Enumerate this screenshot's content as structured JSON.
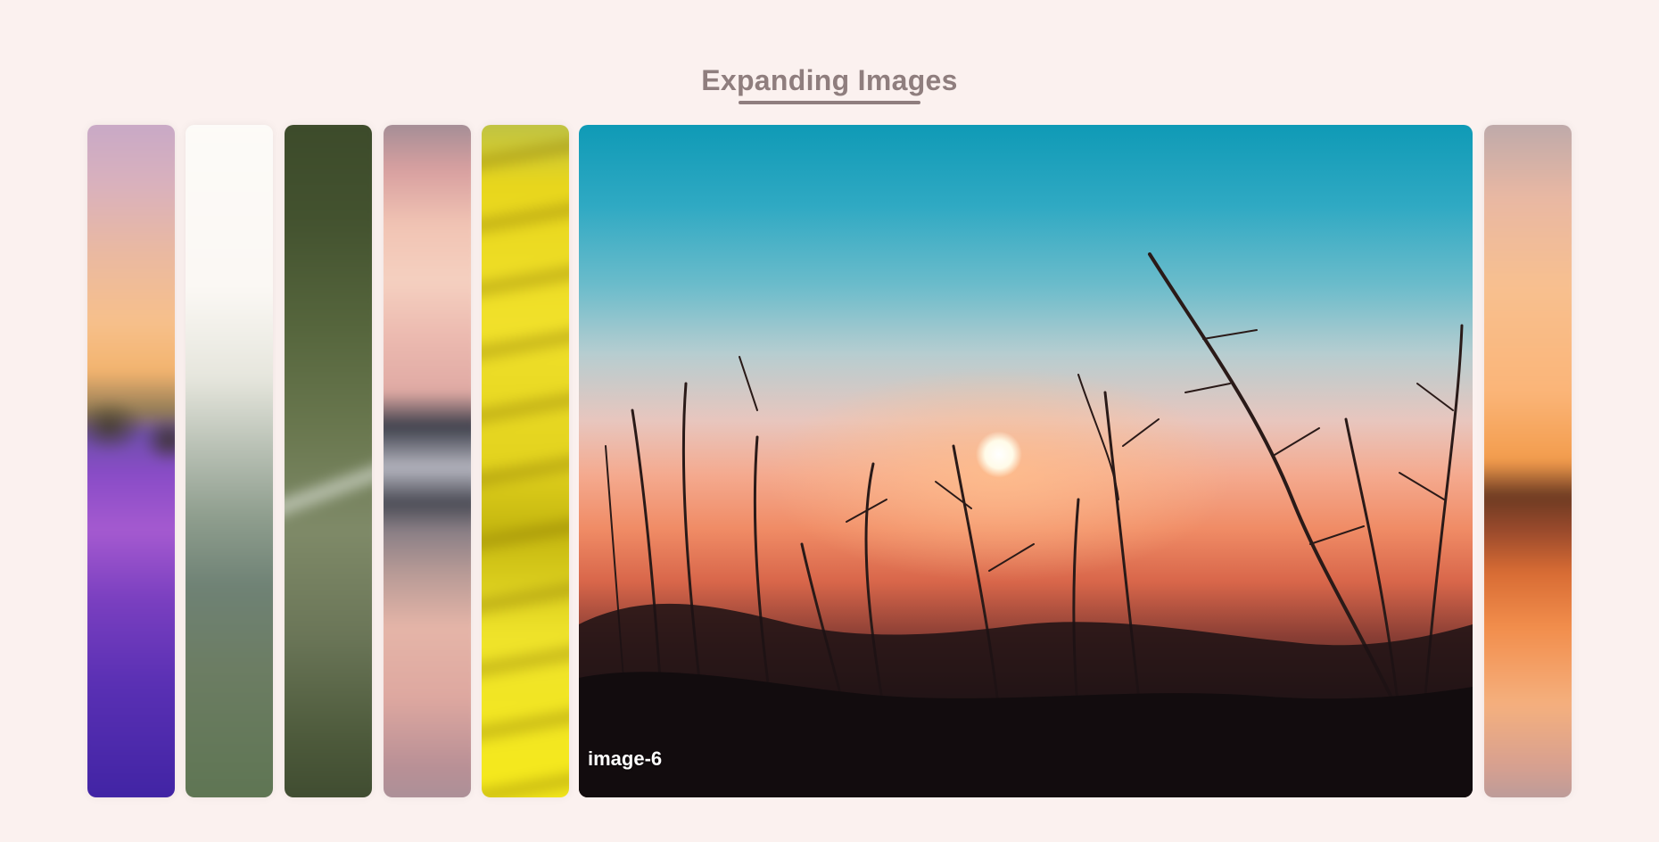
{
  "page": {
    "title": "Expanding Images"
  },
  "gallery": {
    "active_index": 6,
    "panels": [
      {
        "id": 1
      },
      {
        "id": 2
      },
      {
        "id": 3
      },
      {
        "id": 4
      },
      {
        "id": 5
      },
      {
        "id": 6,
        "caption": "image-6"
      },
      {
        "id": 7
      }
    ]
  },
  "colors": {
    "background": "#fbf1ef",
    "title": "#8f7e7e",
    "caption": "#ffffff"
  }
}
